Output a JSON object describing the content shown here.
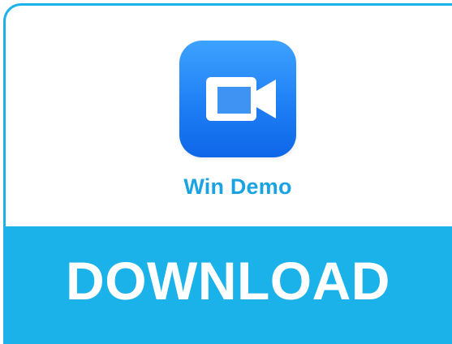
{
  "app": {
    "name": "Win Demo",
    "icon": "video-camera-icon",
    "icon_colors": {
      "top": "#3da2ff",
      "bottom": "#0e66e8",
      "glyph": "#ffffff"
    }
  },
  "download": {
    "label": "DOWNLOAD",
    "color": "#1bb2ea"
  },
  "theme": {
    "accent": "#1bb2ea",
    "title_color": "#1aa3e3"
  }
}
